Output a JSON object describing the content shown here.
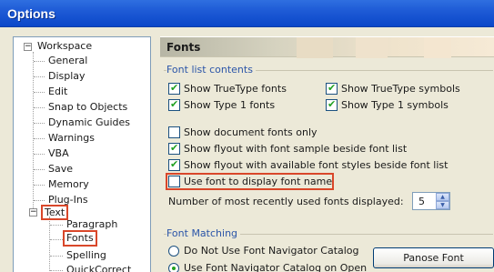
{
  "window": {
    "title": "Options"
  },
  "tree": {
    "root": "Workspace",
    "items": [
      "General",
      "Display",
      "Edit",
      "Snap to Objects",
      "Dynamic Guides",
      "Warnings",
      "VBA",
      "Save",
      "Memory",
      "Plug-Ins"
    ],
    "text_node": "Text",
    "text_children": [
      "Paragraph",
      "Fonts",
      "Spelling",
      "QuickCorrect"
    ]
  },
  "panel": {
    "title": "Fonts",
    "font_list_group": "Font list contents",
    "show_truetype": "Show TrueType fonts",
    "show_truetype_symbols": "Show TrueType symbols",
    "show_type1": "Show Type 1 fonts",
    "show_type1_symbols": "Show Type 1 symbols",
    "show_doc_fonts_only": "Show document fonts only",
    "show_flyout_sample": "Show flyout with font sample beside font list",
    "show_flyout_styles": "Show flyout with available font styles beside font list",
    "use_font_to_display": "Use font to display font name",
    "recent_fonts_label": "Number of most recently used fonts displayed:",
    "recent_fonts_value": "5",
    "font_matching_group": "Font Matching",
    "radio_do_not_use": "Do Not Use Font Navigator Catalog",
    "radio_use": "Use Font Navigator Catalog on Open",
    "panose_button": "Panose Font Matching..."
  },
  "checks": {
    "show_truetype": true,
    "show_truetype_symbols": true,
    "show_type1": true,
    "show_type1_symbols": true,
    "show_doc_fonts_only": false,
    "show_flyout_sample": true,
    "show_flyout_styles": true,
    "use_font_to_display": false
  },
  "selected_radio": "radio_use",
  "colors": {
    "highlight": "#d9472a",
    "title_bar": "#1e5bd6",
    "group_title": "#2b55a8",
    "check": "#21a121"
  }
}
